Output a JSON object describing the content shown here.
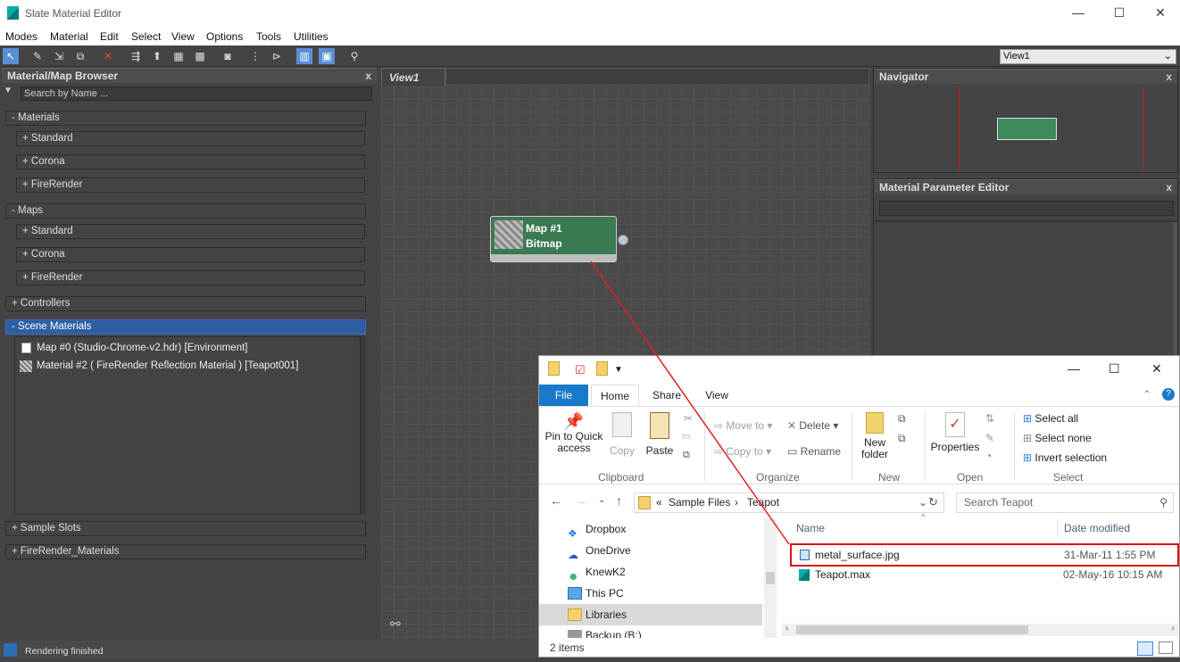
{
  "window": {
    "title": "Slate Material Editor",
    "minimize": "—",
    "maximize": "☐",
    "close": "✕"
  },
  "menu": [
    "Modes",
    "Material",
    "Edit",
    "Select",
    "View",
    "Options",
    "Tools",
    "Utilities"
  ],
  "view_selector": "View1",
  "browser": {
    "title": "Material/Map Browser",
    "close": "x",
    "search_placeholder": "Search by Name ...",
    "groups": {
      "materials": "- Materials",
      "maps": "- Maps",
      "controllers": "+ Controllers",
      "scene_materials": "- Scene Materials",
      "sample_slots": "+ Sample Slots",
      "firerender_materials": "+ FireRender_Materials"
    },
    "material_items": [
      "+ Standard",
      "+ Corona",
      "+ FireRender"
    ],
    "map_items": [
      "+ Standard",
      "+ Corona",
      "+ FireRender"
    ],
    "scene_items": [
      "Map #0 (Studio-Chrome-v2.hdr)  [Environment]",
      "Material #2  ( FireRender Reflection Material )  [Teapot001]"
    ]
  },
  "view": {
    "tab": "View1"
  },
  "node": {
    "name": "Map #1",
    "type": "Bitmap"
  },
  "navigator": {
    "title": "Navigator",
    "close": "x"
  },
  "mpe": {
    "title": "Material Parameter Editor",
    "close": "x"
  },
  "status": {
    "text": "Rendering finished"
  },
  "explorer": {
    "window_min": "—",
    "window_max": "☐",
    "window_close": "✕",
    "tabs": {
      "file": "File",
      "home": "Home",
      "share": "Share",
      "view": "View"
    },
    "clipboard": {
      "pin": "Pin to Quick access",
      "copy": "Copy",
      "paste": "Paste",
      "label": "Clipboard"
    },
    "organize": {
      "move": "Move to",
      "copy_to": "Copy to",
      "delete": "Delete",
      "rename": "Rename",
      "label": "Organize"
    },
    "new": {
      "folder": "New folder",
      "label": "New"
    },
    "open": {
      "properties": "Properties",
      "label": "Open"
    },
    "select": {
      "all": "Select all",
      "none": "Select none",
      "invert": "Invert selection",
      "label": "Select"
    },
    "address": {
      "chevron": "«",
      "seg1": "Sample Files",
      "sep": "›",
      "seg2": "Teapot"
    },
    "search_placeholder": "Search Teapot",
    "nav": [
      "Dropbox",
      "OneDrive",
      "KnewK2",
      "This PC",
      "Libraries",
      "Backup (B:)"
    ],
    "columns": {
      "name": "Name",
      "date": "Date modified"
    },
    "files": [
      {
        "name": "metal_surface.jpg",
        "date": "31-Mar-11 1:55 PM"
      },
      {
        "name": "Teapot.max",
        "date": "02-May-16 10:15 AM"
      }
    ],
    "count": "2 items"
  }
}
